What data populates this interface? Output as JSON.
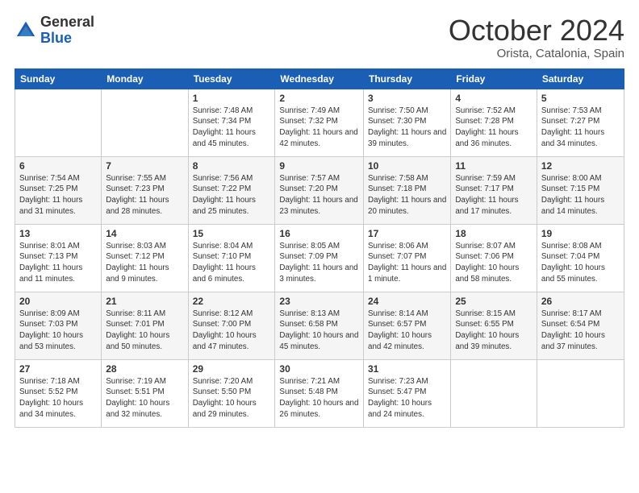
{
  "logo": {
    "general": "General",
    "blue": "Blue"
  },
  "header": {
    "month": "October 2024",
    "location": "Orista, Catalonia, Spain"
  },
  "weekdays": [
    "Sunday",
    "Monday",
    "Tuesday",
    "Wednesday",
    "Thursday",
    "Friday",
    "Saturday"
  ],
  "weeks": [
    [
      {
        "day": "",
        "info": ""
      },
      {
        "day": "",
        "info": ""
      },
      {
        "day": "1",
        "info": "Sunrise: 7:48 AM\nSunset: 7:34 PM\nDaylight: 11 hours and 45 minutes."
      },
      {
        "day": "2",
        "info": "Sunrise: 7:49 AM\nSunset: 7:32 PM\nDaylight: 11 hours and 42 minutes."
      },
      {
        "day": "3",
        "info": "Sunrise: 7:50 AM\nSunset: 7:30 PM\nDaylight: 11 hours and 39 minutes."
      },
      {
        "day": "4",
        "info": "Sunrise: 7:52 AM\nSunset: 7:28 PM\nDaylight: 11 hours and 36 minutes."
      },
      {
        "day": "5",
        "info": "Sunrise: 7:53 AM\nSunset: 7:27 PM\nDaylight: 11 hours and 34 minutes."
      }
    ],
    [
      {
        "day": "6",
        "info": "Sunrise: 7:54 AM\nSunset: 7:25 PM\nDaylight: 11 hours and 31 minutes."
      },
      {
        "day": "7",
        "info": "Sunrise: 7:55 AM\nSunset: 7:23 PM\nDaylight: 11 hours and 28 minutes."
      },
      {
        "day": "8",
        "info": "Sunrise: 7:56 AM\nSunset: 7:22 PM\nDaylight: 11 hours and 25 minutes."
      },
      {
        "day": "9",
        "info": "Sunrise: 7:57 AM\nSunset: 7:20 PM\nDaylight: 11 hours and 23 minutes."
      },
      {
        "day": "10",
        "info": "Sunrise: 7:58 AM\nSunset: 7:18 PM\nDaylight: 11 hours and 20 minutes."
      },
      {
        "day": "11",
        "info": "Sunrise: 7:59 AM\nSunset: 7:17 PM\nDaylight: 11 hours and 17 minutes."
      },
      {
        "day": "12",
        "info": "Sunrise: 8:00 AM\nSunset: 7:15 PM\nDaylight: 11 hours and 14 minutes."
      }
    ],
    [
      {
        "day": "13",
        "info": "Sunrise: 8:01 AM\nSunset: 7:13 PM\nDaylight: 11 hours and 11 minutes."
      },
      {
        "day": "14",
        "info": "Sunrise: 8:03 AM\nSunset: 7:12 PM\nDaylight: 11 hours and 9 minutes."
      },
      {
        "day": "15",
        "info": "Sunrise: 8:04 AM\nSunset: 7:10 PM\nDaylight: 11 hours and 6 minutes."
      },
      {
        "day": "16",
        "info": "Sunrise: 8:05 AM\nSunset: 7:09 PM\nDaylight: 11 hours and 3 minutes."
      },
      {
        "day": "17",
        "info": "Sunrise: 8:06 AM\nSunset: 7:07 PM\nDaylight: 11 hours and 1 minute."
      },
      {
        "day": "18",
        "info": "Sunrise: 8:07 AM\nSunset: 7:06 PM\nDaylight: 10 hours and 58 minutes."
      },
      {
        "day": "19",
        "info": "Sunrise: 8:08 AM\nSunset: 7:04 PM\nDaylight: 10 hours and 55 minutes."
      }
    ],
    [
      {
        "day": "20",
        "info": "Sunrise: 8:09 AM\nSunset: 7:03 PM\nDaylight: 10 hours and 53 minutes."
      },
      {
        "day": "21",
        "info": "Sunrise: 8:11 AM\nSunset: 7:01 PM\nDaylight: 10 hours and 50 minutes."
      },
      {
        "day": "22",
        "info": "Sunrise: 8:12 AM\nSunset: 7:00 PM\nDaylight: 10 hours and 47 minutes."
      },
      {
        "day": "23",
        "info": "Sunrise: 8:13 AM\nSunset: 6:58 PM\nDaylight: 10 hours and 45 minutes."
      },
      {
        "day": "24",
        "info": "Sunrise: 8:14 AM\nSunset: 6:57 PM\nDaylight: 10 hours and 42 minutes."
      },
      {
        "day": "25",
        "info": "Sunrise: 8:15 AM\nSunset: 6:55 PM\nDaylight: 10 hours and 39 minutes."
      },
      {
        "day": "26",
        "info": "Sunrise: 8:17 AM\nSunset: 6:54 PM\nDaylight: 10 hours and 37 minutes."
      }
    ],
    [
      {
        "day": "27",
        "info": "Sunrise: 7:18 AM\nSunset: 5:52 PM\nDaylight: 10 hours and 34 minutes."
      },
      {
        "day": "28",
        "info": "Sunrise: 7:19 AM\nSunset: 5:51 PM\nDaylight: 10 hours and 32 minutes."
      },
      {
        "day": "29",
        "info": "Sunrise: 7:20 AM\nSunset: 5:50 PM\nDaylight: 10 hours and 29 minutes."
      },
      {
        "day": "30",
        "info": "Sunrise: 7:21 AM\nSunset: 5:48 PM\nDaylight: 10 hours and 26 minutes."
      },
      {
        "day": "31",
        "info": "Sunrise: 7:23 AM\nSunset: 5:47 PM\nDaylight: 10 hours and 24 minutes."
      },
      {
        "day": "",
        "info": ""
      },
      {
        "day": "",
        "info": ""
      }
    ]
  ]
}
